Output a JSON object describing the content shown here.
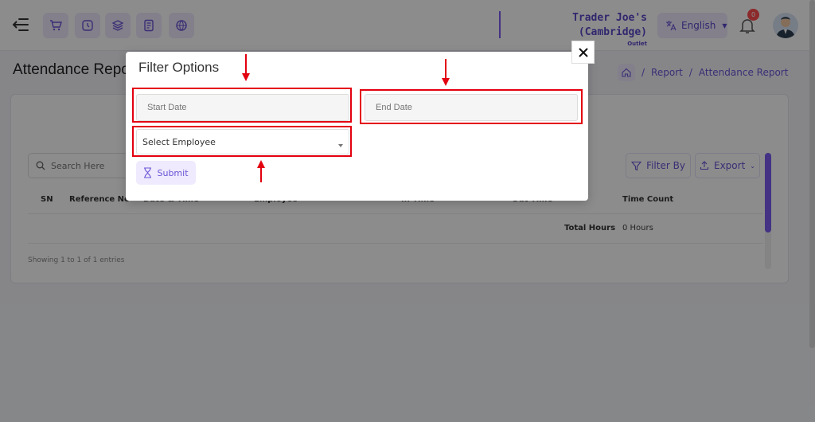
{
  "header": {
    "outlet_name": "Trader Joe's (Cambridge)",
    "outlet_sub": "Outlet",
    "language": "English",
    "notification_count": "0",
    "icons": [
      "cart-icon",
      "clock-icon",
      "layers-icon",
      "receipt-icon",
      "globe-icon"
    ]
  },
  "page": {
    "title": "Attendance Report",
    "breadcrumb": [
      "Report",
      "Attendance Report"
    ]
  },
  "table": {
    "search_placeholder": "Search Here",
    "filter_label": "Filter By",
    "export_label": "Export",
    "columns": [
      "SN",
      "Reference No",
      "Date & Time",
      "Employee",
      "In Time",
      "Out Time",
      "Time Count"
    ],
    "total_label": "Total Hours",
    "total_value": "0 Hours",
    "entries_text": "Showing 1 to 1 of 1 entries"
  },
  "modal": {
    "title": "Filter Options",
    "start_date_placeholder": "Start Date",
    "end_date_placeholder": "End Date",
    "employee_select": "Select Employee",
    "submit_label": "Submit",
    "close_symbol": "✕"
  },
  "colors": {
    "accent": "#6a55d6",
    "highlight": "#e3000f"
  }
}
